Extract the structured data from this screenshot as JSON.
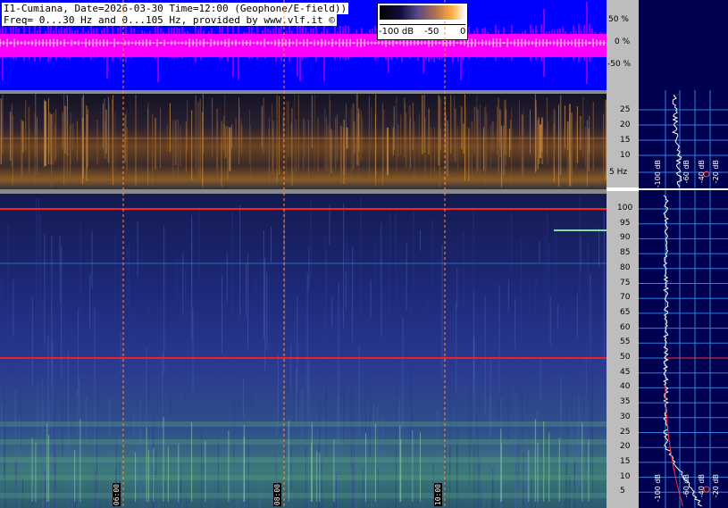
{
  "header": {
    "line1": "I1-Cumiana, Date=2026-03-30 Time=12:00 (Geophone/E-field))",
    "line2": "Freq= 0...30 Hz and 0...105 Hz, provided by www.vlf.it ©"
  },
  "colorbar": {
    "labels": [
      "-100 dB",
      "-50",
      "0"
    ]
  },
  "waveform_axis": {
    "labels": [
      "50 %",
      "0 %",
      "-50 %"
    ]
  },
  "lowfreq_axis": {
    "labels": [
      "25",
      "20",
      "15",
      "10",
      "5 Hz"
    ]
  },
  "mainfreq_axis": {
    "labels": [
      "100",
      "95",
      "90",
      "85",
      "80",
      "75",
      "70",
      "65",
      "60",
      "55",
      "50",
      "45",
      "40",
      "35",
      "30",
      "25",
      "20",
      "15",
      "10",
      "5"
    ]
  },
  "spectrum_labels": {
    "upper": [
      "-100 dB",
      "-60 dB",
      "-40 dB",
      "-20 dB"
    ],
    "lower": [
      "-100 dB",
      "-60 dB",
      "-40 dB",
      "-20 dB"
    ]
  },
  "time_markers": [
    "06:00",
    "08:00",
    "10:00"
  ],
  "colors": {
    "waveform_bg": "#0000ff",
    "waveform_trace": "#ff00ff",
    "axis_bg": "#bdbdbd",
    "spectrum_bg": "#000050",
    "mainline": "#ff2020"
  }
}
